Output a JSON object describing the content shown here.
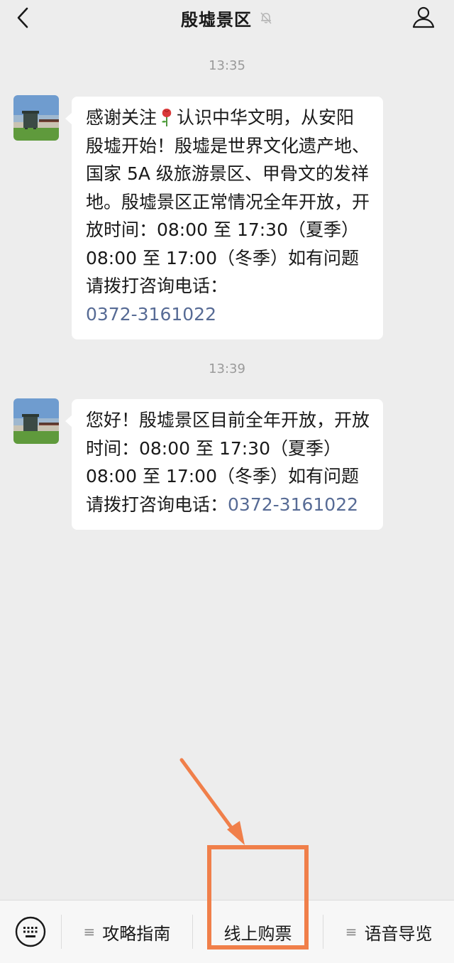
{
  "header": {
    "title": "殷墟景区",
    "back_icon": "chevron-left-icon",
    "mute_icon": "bell-muted-icon",
    "profile_icon": "person-icon"
  },
  "messages": [
    {
      "time": "13:35",
      "text_before_emoji": "感谢关注",
      "emoji": "rose-icon",
      "text_after_emoji": "认识中华文明，从安阳殷墟开始！殷墟是世界文化遗产地、国家 5A 级旅游景区、甲骨文的发祥地。殷墟景区正常情况全年开放，开放时间：08:00 至 17:30（夏季）08:00 至 17:00（冬季）如有问题请拨打咨询电话：",
      "phone": "0372-3161022"
    },
    {
      "time": "13:39",
      "text": "您好！殷墟景区目前全年开放，开放时间：08:00 至 17:30（夏季）08:00 至 17:00（冬季）如有问题请拨打咨询电话：",
      "phone": "0372-3161022"
    }
  ],
  "menu": {
    "keyboard_icon": "keyboard-icon",
    "items": [
      {
        "label": "攻略指南",
        "has_submenu": true
      },
      {
        "label": "线上购票",
        "has_submenu": false
      },
      {
        "label": "语音导览",
        "has_submenu": true
      }
    ],
    "submenu_icon": "≡"
  },
  "colors": {
    "background": "#ededed",
    "bubble": "#ffffff",
    "link": "#576b95",
    "annotation": "#f07f4a"
  }
}
